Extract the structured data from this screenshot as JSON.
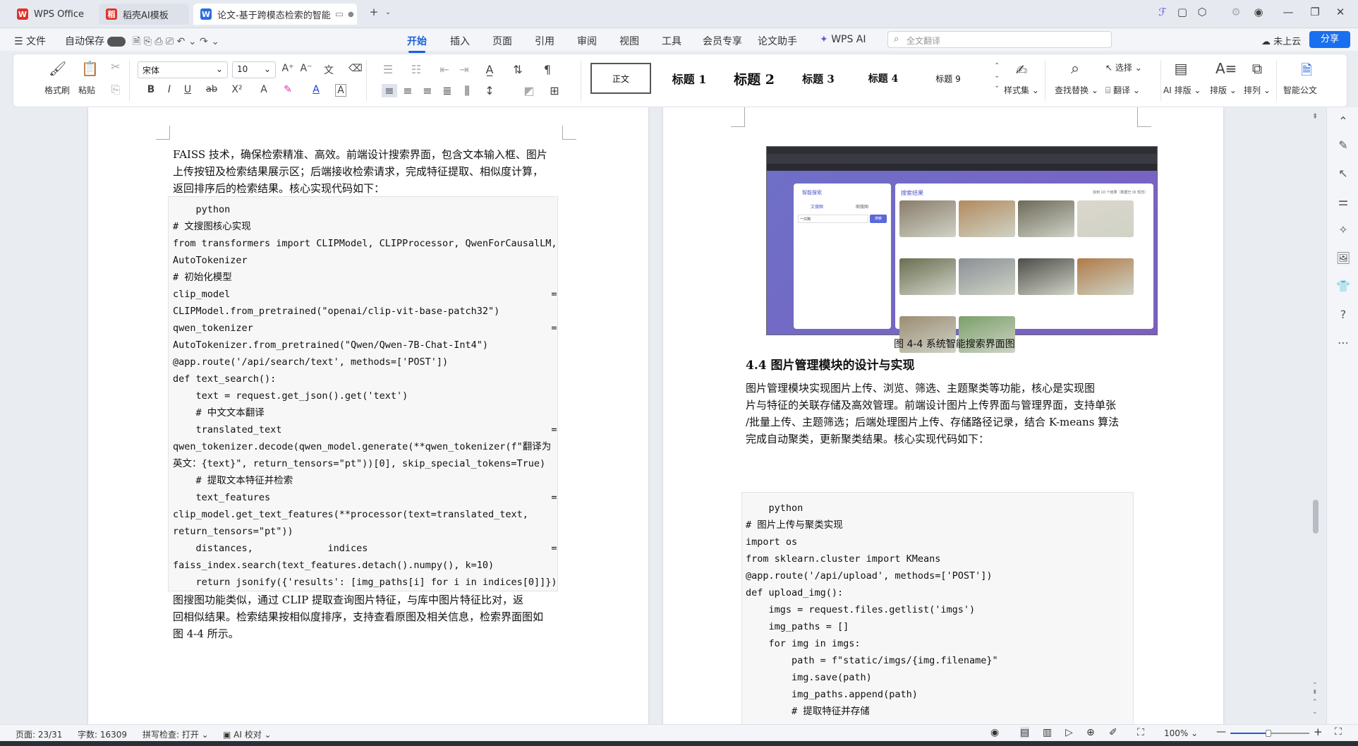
{
  "tabs": [
    {
      "label": "WPS Office",
      "icon": "wps-logo-icon"
    },
    {
      "label": "稻壳AI模板",
      "icon": "docer-icon"
    },
    {
      "label": "论文-基于跨模态检索的智能",
      "icon": "writer-icon"
    }
  ],
  "menu": {
    "file": "文件",
    "autosave": "自动保存",
    "items": [
      "开始",
      "插入",
      "页面",
      "引用",
      "审阅",
      "视图",
      "工具",
      "会员专享",
      "论文助手",
      "WPS AI"
    ],
    "active": "开始",
    "search_placeholder": "全文翻译",
    "cloud": "未上云",
    "share": "分享"
  },
  "ribbon": {
    "format_painter": "格式刷",
    "paste": "粘贴",
    "font_name": "宋体",
    "font_size": "10",
    "styles": [
      "正文",
      "标题 1",
      "标题 2",
      "标题 3",
      "标题 4",
      "标题 9"
    ],
    "style_set": "样式集",
    "find_replace": "查找替换",
    "select": "选择",
    "translate": "翻译",
    "ai_layout": "AI 排版",
    "layout": "排版",
    "arrange": "排列",
    "smart_doc": "智能公文"
  },
  "left_page": {
    "intro": [
      "FAISS 技术，确保检索精准、高效。前端设计搜索界面，包含文本输入框、图片",
      "上传按钮及检索结果展示区；后端接收检索请求，完成特征提取、相似度计算，",
      "返回排序后的检索结果。核心实现代码如下："
    ],
    "code": [
      "    python",
      "# 文搜图核心实现",
      "from transformers import CLIPModel, CLIPProcessor, QwenForCausalLM,",
      "AutoTokenizer",
      "# 初始化模型",
      "clip_model                                                        =",
      "CLIPModel.from_pretrained(\"openai/clip-vit-base-patch32\")",
      "qwen_tokenizer                                                    =",
      "AutoTokenizer.from_pretrained(\"Qwen/Qwen-7B-Chat-Int4\")",
      "@app.route('/api/search/text', methods=['POST'])",
      "def text_search():",
      "    text = request.get_json().get('text')",
      "    # 中文文本翻译",
      "    translated_text                                               =",
      "qwen_tokenizer.decode(qwen_model.generate(**qwen_tokenizer(f\"翻译为",
      "英文：{text}\", return_tensors=\"pt\"))[0], skip_special_tokens=True)",
      "    # 提取文本特征并检索",
      "    text_features                                                 =",
      "clip_model.get_text_features(**processor(text=translated_text,",
      "return_tensors=\"pt\"))",
      "    distances,             indices                                =",
      "faiss_index.search(text_features.detach().numpy(), k=10)",
      "    return jsonify({'results': [img_paths[i] for i in indices[0]]})"
    ],
    "outro": [
      "    图搜图功能类似，通过 CLIP 提取查询图片特征，与库中图片特征比对，返",
      "回相似结果。检索结果按相似度排序，支持查看原图及相关信息，检索界面图如",
      "图 4-4 所示。"
    ]
  },
  "right_page": {
    "screenshot": {
      "left_title": "智能搜索",
      "tab1": "文搜图",
      "tab2": "图搜图",
      "query": "一只狗",
      "search_btn": "搜索",
      "results_title": "搜索结果",
      "results_count": "找到 10 个结果（数据已 ID 规范）"
    },
    "caption": "图 4-4  系统智能搜索界面图",
    "heading": "4.4  图片管理模块的设计与实现",
    "paragraph": [
      "    图片管理模块实现图片上传、浏览、筛选、主题聚类等功能，核心是实现图",
      "片与特征的关联存储及高效管理。前端设计图片上传界面与管理界面，支持单张",
      "/批量上传、主题筛选；后端处理图片上传、存储路径记录，结合 K-means 算法",
      "完成自动聚类，更新聚类结果。核心实现代码如下："
    ],
    "code": [
      "    python",
      "# 图片上传与聚类实现",
      "import os",
      "from sklearn.cluster import KMeans",
      "@app.route('/api/upload', methods=['POST'])",
      "def upload_img():",
      "    imgs = request.files.getlist('imgs')",
      "    img_paths = []",
      "    for img in imgs:",
      "        path = f\"static/imgs/{img.filename}\"",
      "        img.save(path)",
      "        img_paths.append(path)",
      "        # 提取特征并存储"
    ]
  },
  "status": {
    "page": "页面: 23/31",
    "words": "字数: 16309",
    "spell": "拼写检查: 打开",
    "ai_check": "AI 校对",
    "zoom": "100%"
  },
  "colors": {
    "accent": "#1a5fd8",
    "ribbon_bg": "#ffffff",
    "page_bg": "#e9ecf1"
  }
}
